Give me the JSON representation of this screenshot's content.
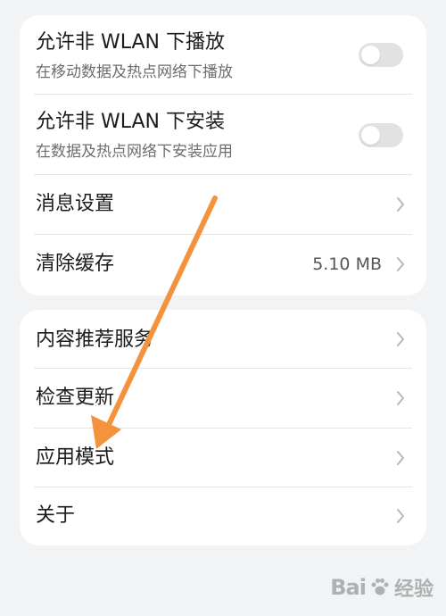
{
  "settings_group_1": {
    "items": [
      {
        "title": "允许非 WLAN 下播放",
        "subtitle": "在移动数据及热点网络下播放",
        "toggle_on": false
      },
      {
        "title": "允许非 WLAN 下安装",
        "subtitle": "在数据及热点网络下安装应用",
        "toggle_on": false
      },
      {
        "title": "消息设置"
      },
      {
        "title": "清除缓存",
        "value": "5.10 MB"
      }
    ]
  },
  "settings_group_2": {
    "items": [
      {
        "title": "内容推荐服务"
      },
      {
        "title": "检查更新"
      },
      {
        "title": "应用模式"
      },
      {
        "title": "关于"
      }
    ]
  },
  "annotation": {
    "color": "#f5923e"
  },
  "watermark": {
    "left_text": "Bai",
    "right_text": "经验"
  }
}
